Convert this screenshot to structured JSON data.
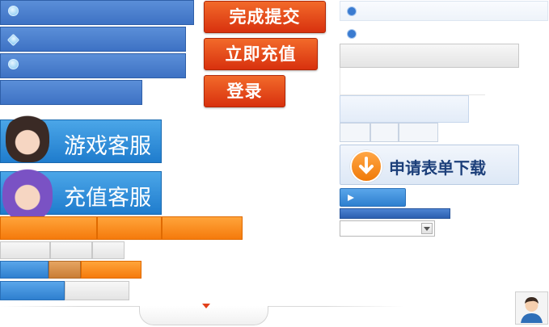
{
  "buttons": {
    "submit": "完成提交",
    "recharge": "立即充值",
    "login": "登录"
  },
  "services": {
    "game_service": "游戏客服",
    "recharge_service": "充值客服"
  },
  "right_panel": {
    "download_form": "申请表单下载"
  },
  "icons": {
    "chat": "chat-bubble-icon",
    "diamond": "diamond-icon",
    "download": "download-arrow-icon",
    "dropdown": "chevron-down-icon",
    "play": "play-arrow-icon",
    "user": "user-avatar-icon"
  },
  "colors": {
    "accent_red": "#e0401a",
    "accent_blue": "#3d72c4",
    "accent_orange": "#f88a1a"
  }
}
